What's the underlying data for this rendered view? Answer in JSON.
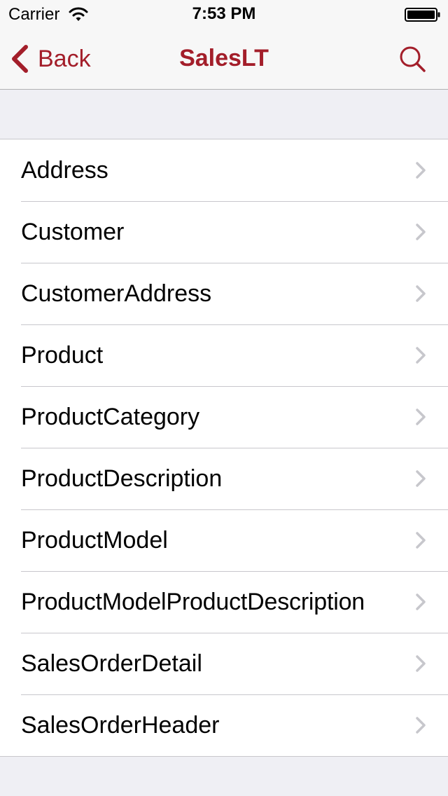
{
  "status_bar": {
    "carrier": "Carrier",
    "time": "7:53 PM"
  },
  "nav_bar": {
    "back_label": "Back",
    "title": "SalesLT",
    "search_icon": "search-icon"
  },
  "tables": {
    "items": [
      {
        "label": "Address"
      },
      {
        "label": "Customer"
      },
      {
        "label": "CustomerAddress"
      },
      {
        "label": "Product"
      },
      {
        "label": "ProductCategory"
      },
      {
        "label": "ProductDescription"
      },
      {
        "label": "ProductModel"
      },
      {
        "label": "ProductModelProductDescription"
      },
      {
        "label": "SalesOrderDetail"
      },
      {
        "label": "SalesOrderHeader"
      }
    ]
  },
  "colors": {
    "accent": "#a31e2a",
    "background": "#efeff4",
    "separator": "#c8c7cc",
    "disclosure": "#c7c7cc"
  }
}
